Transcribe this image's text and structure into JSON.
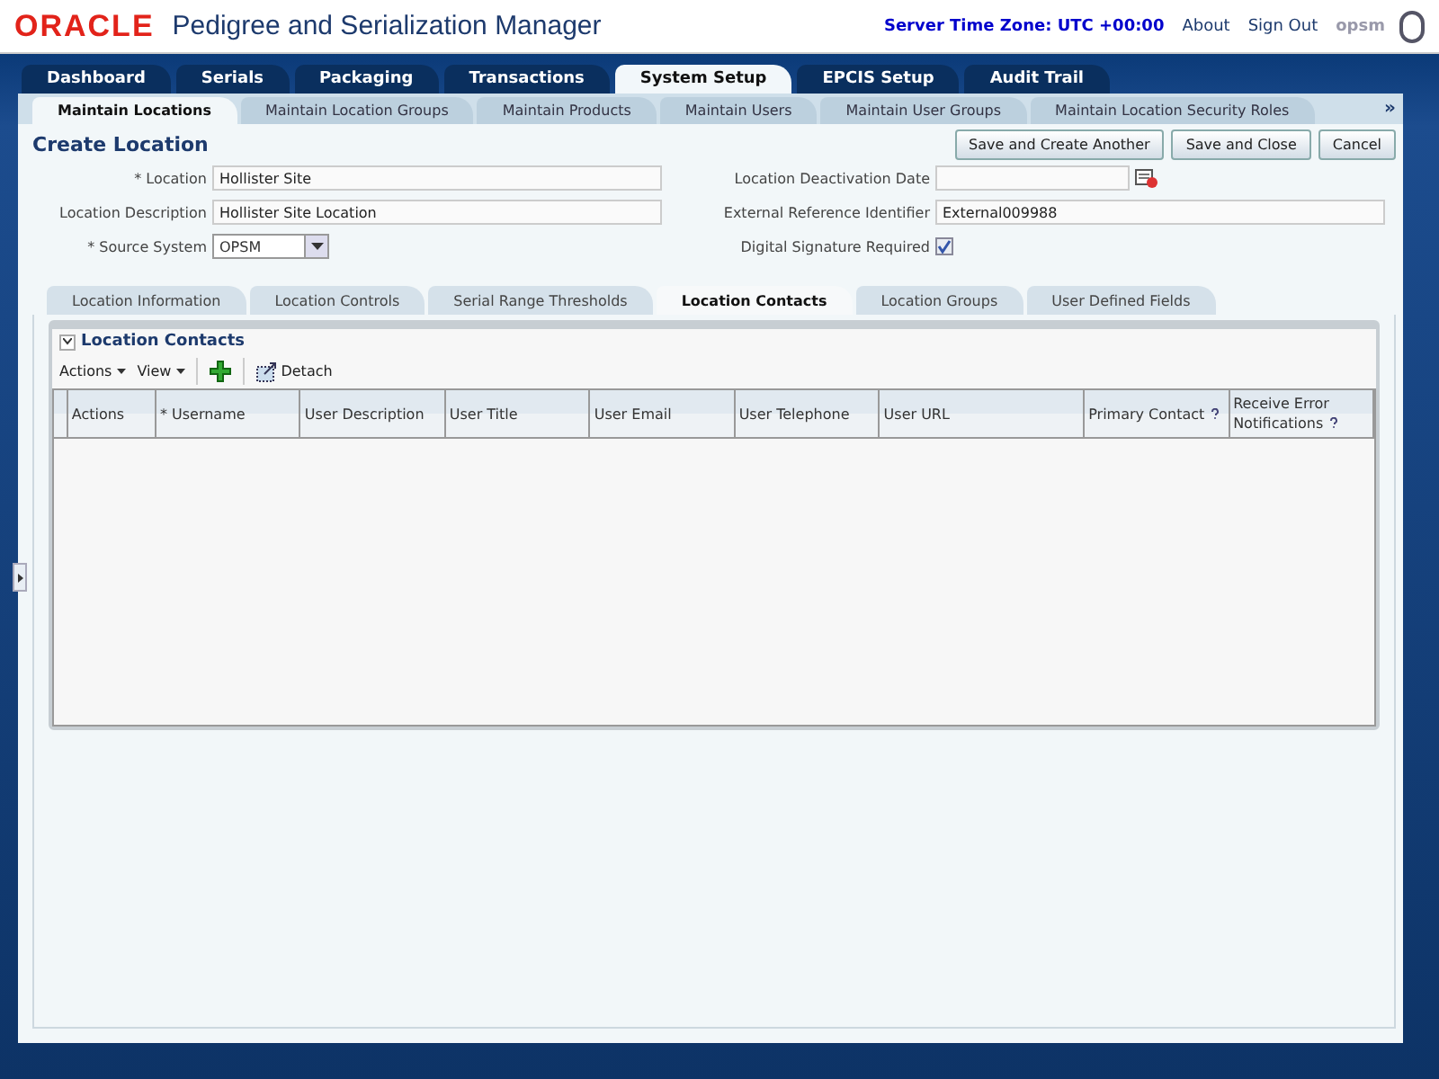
{
  "header": {
    "logo": "ORACLE",
    "title": "Pedigree and Serialization Manager",
    "server_time": "Server Time Zone: UTC +00:00",
    "links": [
      "About",
      "Sign Out"
    ],
    "user": "opsm"
  },
  "main_tabs": [
    {
      "label": "Dashboard",
      "selected": false
    },
    {
      "label": "Serials",
      "selected": false
    },
    {
      "label": "Packaging",
      "selected": false
    },
    {
      "label": "Transactions",
      "selected": false
    },
    {
      "label": "System Setup",
      "selected": true
    },
    {
      "label": "EPCIS Setup",
      "selected": false
    },
    {
      "label": "Audit Trail",
      "selected": false
    }
  ],
  "sub_tabs": [
    {
      "label": "Maintain Locations",
      "selected": true
    },
    {
      "label": "Maintain Location Groups",
      "selected": false
    },
    {
      "label": "Maintain Products",
      "selected": false
    },
    {
      "label": "Maintain Users",
      "selected": false
    },
    {
      "label": "Maintain User Groups",
      "selected": false
    },
    {
      "label": "Maintain Location Security Roles",
      "selected": false
    }
  ],
  "sub_tabs_overflow": "»",
  "page_title": "Create Location",
  "buttons": [
    "Save and Create Another",
    "Save and Close",
    "Cancel"
  ],
  "form_left": [
    {
      "label": "* Location",
      "kind": "text",
      "value": "Hollister Site"
    },
    {
      "label": "Location Description",
      "kind": "text",
      "value": "Hollister Site Location"
    },
    {
      "label": "* Source System",
      "kind": "select",
      "value": "OPSM"
    }
  ],
  "form_right": [
    {
      "label": "Location Deactivation Date",
      "kind": "date"
    },
    {
      "label": "External Reference Identifier",
      "kind": "text",
      "value": "External009988"
    },
    {
      "label": "Digital Signature Required",
      "kind": "checkbox",
      "checked": true
    }
  ],
  "detail_tabs": [
    {
      "label": "Location Information",
      "selected": false
    },
    {
      "label": "Location Controls",
      "selected": false
    },
    {
      "label": "Serial Range Thresholds",
      "selected": false
    },
    {
      "label": "Location Contacts",
      "selected": true
    },
    {
      "label": "Location Groups",
      "selected": false
    },
    {
      "label": "User Defined Fields",
      "selected": false
    }
  ],
  "section": {
    "title": "Location Contacts",
    "expanded": true,
    "menus": [
      "Actions",
      "View"
    ],
    "detach": "Detach",
    "columns": [
      {
        "label": "Actions",
        "help": false
      },
      {
        "label": "* Username",
        "help": false
      },
      {
        "label": "User Description",
        "help": false
      },
      {
        "label": "User Title",
        "help": false
      },
      {
        "label": "User Email",
        "help": false
      },
      {
        "label": "User Telephone",
        "help": false
      },
      {
        "label": "User URL",
        "help": false
      },
      {
        "label": "Primary Contact",
        "help": true
      },
      {
        "label": "Receive Error Notifications",
        "help": true
      }
    ]
  }
}
